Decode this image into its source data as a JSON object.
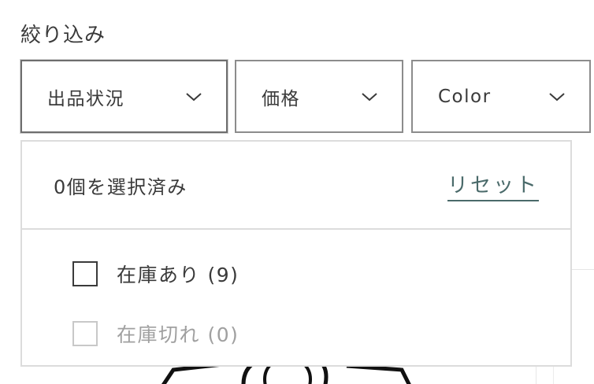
{
  "filter": {
    "heading": "絞り込み",
    "buttons": [
      {
        "label": "出品状況",
        "icon": "chevron-down-icon"
      },
      {
        "label": "価格",
        "icon": "chevron-down-icon"
      },
      {
        "label": "Color",
        "icon": "chevron-down-icon"
      }
    ]
  },
  "dropdown": {
    "selected_count": "0個を選択済み",
    "reset_label": "リセット",
    "options": [
      {
        "label": "在庫あり (9)",
        "enabled": true
      },
      {
        "label": "在庫切れ (0)",
        "enabled": false
      }
    ]
  },
  "colors": {
    "text": "#3a3a3a",
    "muted": "#a0a0a0",
    "border": "#8c8c8c",
    "reset_link": "#4a6a6a"
  }
}
